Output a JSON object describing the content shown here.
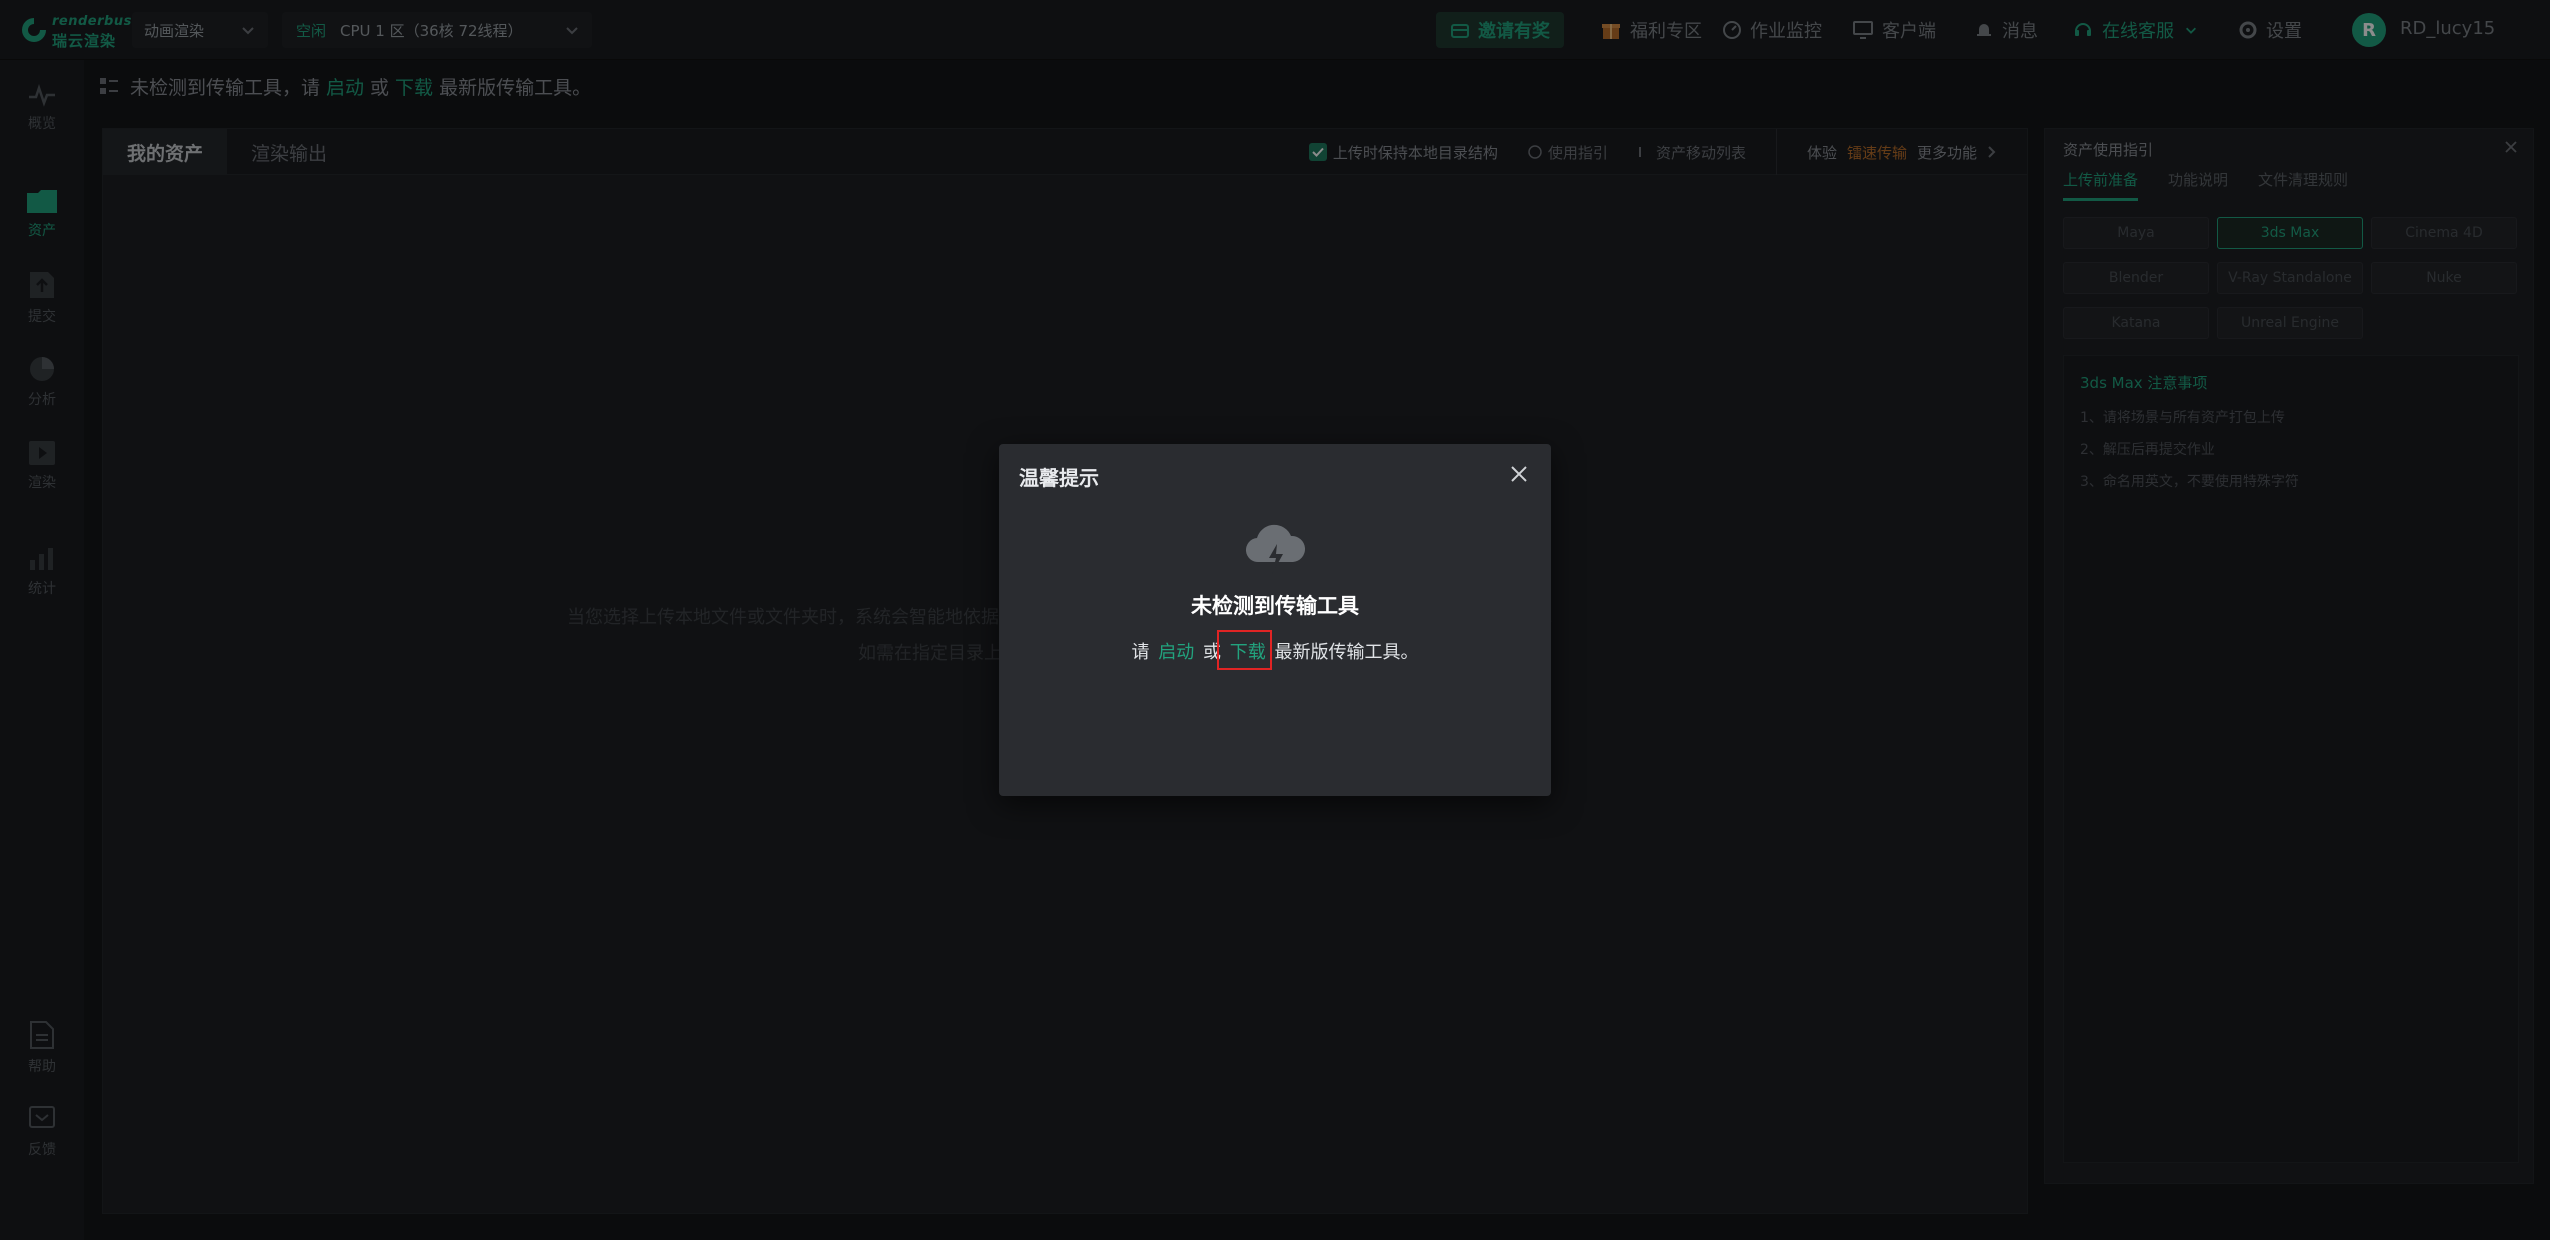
{
  "topbar": {
    "logo_en": "renderbus",
    "logo_cn": "瑞云渲染",
    "mode": "动画渲染",
    "zone_status": "空闲",
    "zone_name": "CPU 1 区（36核 72线程）",
    "invite": "邀请有奖",
    "welfare": "福利专区",
    "monitor": "作业监控",
    "client": "客户端",
    "messages": "消息",
    "online_service": "在线客服",
    "settings": "设置",
    "avatar_letter": "R",
    "username": "RD_lucy15"
  },
  "sidebar": {
    "items": [
      {
        "label": "概览"
      },
      {
        "label": "资产"
      },
      {
        "label": "提交"
      },
      {
        "label": "分析"
      },
      {
        "label": "渲染"
      },
      {
        "label": "统计"
      },
      {
        "label": "帮助"
      },
      {
        "label": "反馈"
      }
    ]
  },
  "notice": {
    "prefix": "未检测到传输工具，请",
    "launch": "启动",
    "or": "或",
    "download": "下载",
    "suffix": "最新版传输工具。"
  },
  "main": {
    "tabs": [
      {
        "label": "我的资产"
      },
      {
        "label": "渲染输出"
      }
    ],
    "keep_structure": "上传时保持本地目录结构",
    "guide_link": "使用指引",
    "move_list": "资产移动列表",
    "experience": "体验",
    "speed_transfer": "镭速传输",
    "more_features": "更多功能",
    "empty_line1": "当",
    "empty_line2": "当您选择上传本地文件或文件夹时，系统会智能地依据这些文件/文件夹在本地的目录结构来保存，目录结构与本地保持一致。",
    "empty_line3": "如需在指定目录上传文件或文件夹，请先创建目录。"
  },
  "guide": {
    "title": "资产使用指引",
    "tabs": [
      {
        "label": "上传前准备"
      },
      {
        "label": "功能说明"
      },
      {
        "label": "文件清理规则"
      }
    ],
    "software": [
      {
        "label": "Maya"
      },
      {
        "label": "3ds Max"
      },
      {
        "label": "Cinema 4D"
      },
      {
        "label": "Blender"
      },
      {
        "label": "V-Ray Standalone"
      },
      {
        "label": "Nuke"
      },
      {
        "label": "Katana"
      },
      {
        "label": "Unreal Engine"
      }
    ],
    "notes_title": "3ds Max 注意事项",
    "notes": [
      "1、请将场景与所有资产打包上传",
      "2、解压后再提交作业",
      "3、命名用英文，不要使用特殊字符"
    ]
  },
  "modal": {
    "title": "温馨提示",
    "heading": "未检测到传输工具",
    "please": "请",
    "launch": "启动",
    "or": "或",
    "download": "下载",
    "suffix": "最新版传输工具。"
  },
  "colors": {
    "accent": "#22a37e",
    "highlight": "#e02424",
    "orange": "#b96d2a"
  }
}
